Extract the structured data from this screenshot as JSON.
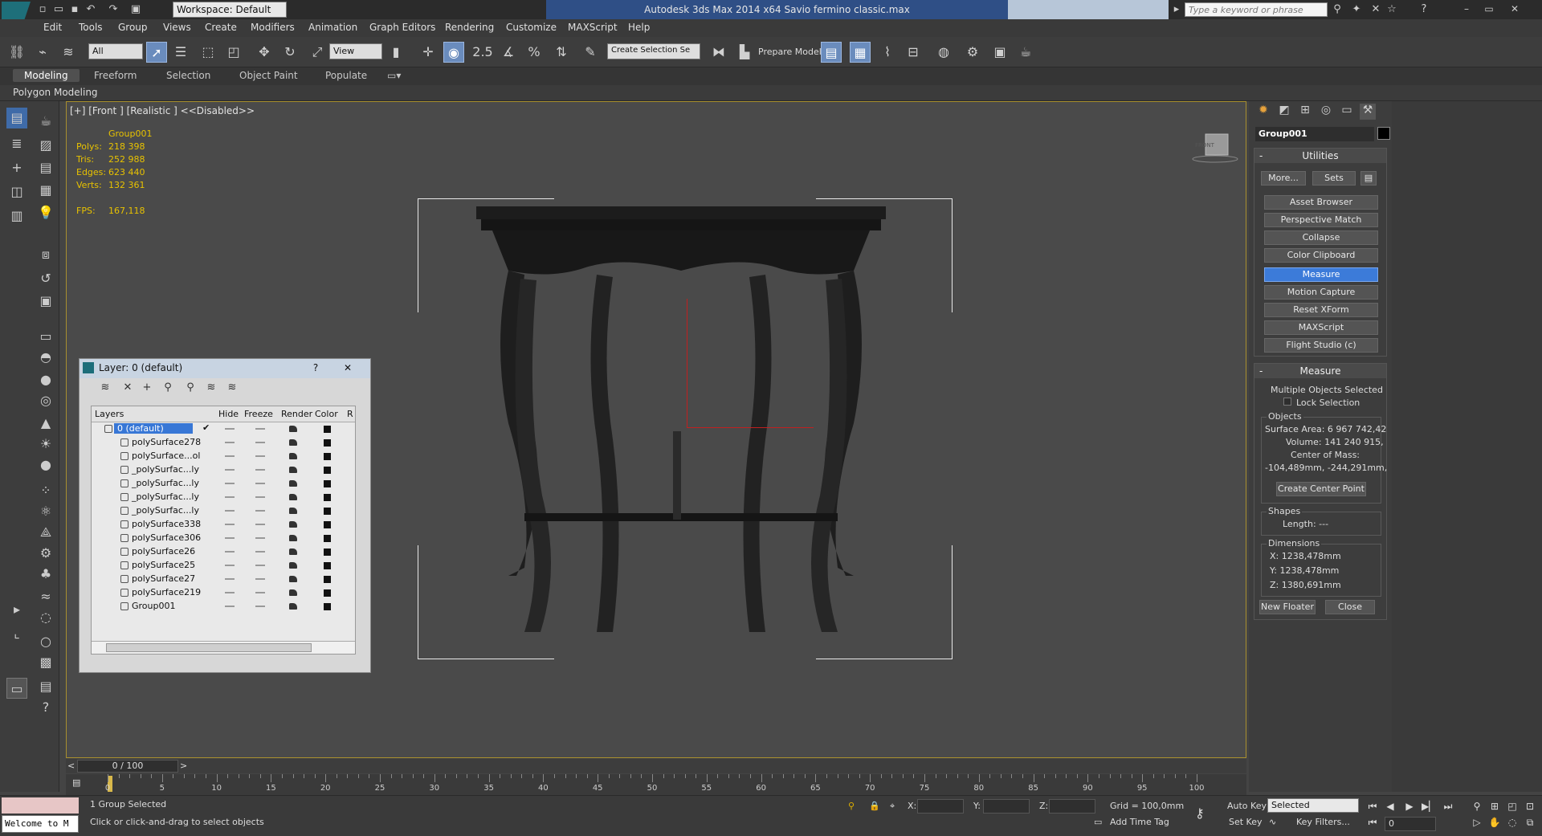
{
  "titlebar": {
    "workspace": "Workspace: Default",
    "app_title": "Autodesk 3ds Max  2014 x64     Savio fermino classic.max",
    "search_placeholder": "Type a keyword or phrase"
  },
  "menu": [
    "Edit",
    "Tools",
    "Group",
    "Views",
    "Create",
    "Modifiers",
    "Animation",
    "Graph Editors",
    "Rendering",
    "Customize",
    "MAXScript",
    "Help"
  ],
  "toolbar": {
    "selection_filter": "All",
    "ref_coord": "View",
    "snap_value": "2.5",
    "named_selection": "Create Selection Se",
    "prepare_model": "Prepare Model"
  },
  "ribbon": {
    "tabs": [
      "Modeling",
      "Freeform",
      "Selection",
      "Object Paint",
      "Populate"
    ],
    "active_tab": "Modeling",
    "sub_label": "Polygon Modeling"
  },
  "viewport": {
    "label": "[+] [Front ] [Realistic ]  <<Disabled>>",
    "stats": {
      "object": "Group001",
      "polys_label": "Polys:",
      "polys": "218 398",
      "tris_label": "Tris:",
      "tris": "252 988",
      "edges_label": "Edges:",
      "edges": "623 440",
      "verts_label": "Verts:",
      "verts": "132 361",
      "fps_label": "FPS:",
      "fps": "167,118"
    },
    "viewcube_label": "FRONT"
  },
  "layer_manager": {
    "title": "Layer: 0 (default)",
    "help": "?",
    "close": "✕",
    "columns": [
      "Layers",
      "Hide",
      "Freeze",
      "Render",
      "Color",
      "R"
    ],
    "rows": [
      {
        "name": "0 (default)",
        "selected": true
      },
      {
        "name": "polySurface278"
      },
      {
        "name": "polySurface...ol"
      },
      {
        "name": "_polySurfac...ly"
      },
      {
        "name": "_polySurfac...ly"
      },
      {
        "name": "_polySurfac...ly"
      },
      {
        "name": "_polySurfac...ly"
      },
      {
        "name": "polySurface338"
      },
      {
        "name": "polySurface306"
      },
      {
        "name": "polySurface26"
      },
      {
        "name": "polySurface25"
      },
      {
        "name": "polySurface27"
      },
      {
        "name": "polySurface219"
      },
      {
        "name": "Group001"
      }
    ]
  },
  "command_panel": {
    "object_name": "Group001",
    "utilities": {
      "title": "Utilities",
      "more": "More...",
      "sets": "Sets",
      "buttons": [
        "Asset Browser",
        "Perspective Match",
        "Collapse",
        "Color Clipboard",
        "Measure",
        "Motion Capture",
        "Reset XForm",
        "MAXScript",
        "Flight Studio (c)"
      ],
      "active": "Measure"
    },
    "measure": {
      "title": "Measure",
      "multi": "Multiple Objects Selected",
      "lock": "Lock Selection",
      "objects_label": "Objects",
      "surface_area": "Surface Area: 6 967 742,42",
      "volume": "Volume:  141 240 915,",
      "center_of_mass": "Center of Mass:",
      "com_value": "-104,489mm, -244,291mm,",
      "create_center_point": "Create Center Point",
      "shapes_label": "Shapes",
      "length": "Length: ---",
      "dimensions_label": "Dimensions",
      "x": "X:   1238,478mm",
      "y": "Y:   1238,478mm",
      "z": "Z:   1380,691mm",
      "new_floater": "New Floater",
      "close": "Close"
    }
  },
  "timeline": {
    "frame": "0 / 100",
    "ticks": [
      "0",
      "5",
      "10",
      "15",
      "20",
      "25",
      "30",
      "35",
      "40",
      "45",
      "50",
      "55",
      "60",
      "65",
      "70",
      "75",
      "80",
      "85",
      "90",
      "95",
      "100"
    ]
  },
  "status": {
    "welcome": "Welcome to M",
    "selected": "1 Group Selected",
    "prompt": "Click or click-and-drag to select objects",
    "x_label": "X:",
    "y_label": "Y:",
    "z_label": "Z:",
    "grid": "Grid = 100,0mm",
    "add_time_tag": "Add Time Tag",
    "auto_key": "Auto Key",
    "set_key": "Set Key",
    "key_mode": "Selected",
    "key_filters": "Key Filters...",
    "current_frame": "0"
  },
  "colors": {
    "accent": "#3c7bd9",
    "viewport_border": "#a88f2e",
    "stats_text": "#e8c200"
  }
}
